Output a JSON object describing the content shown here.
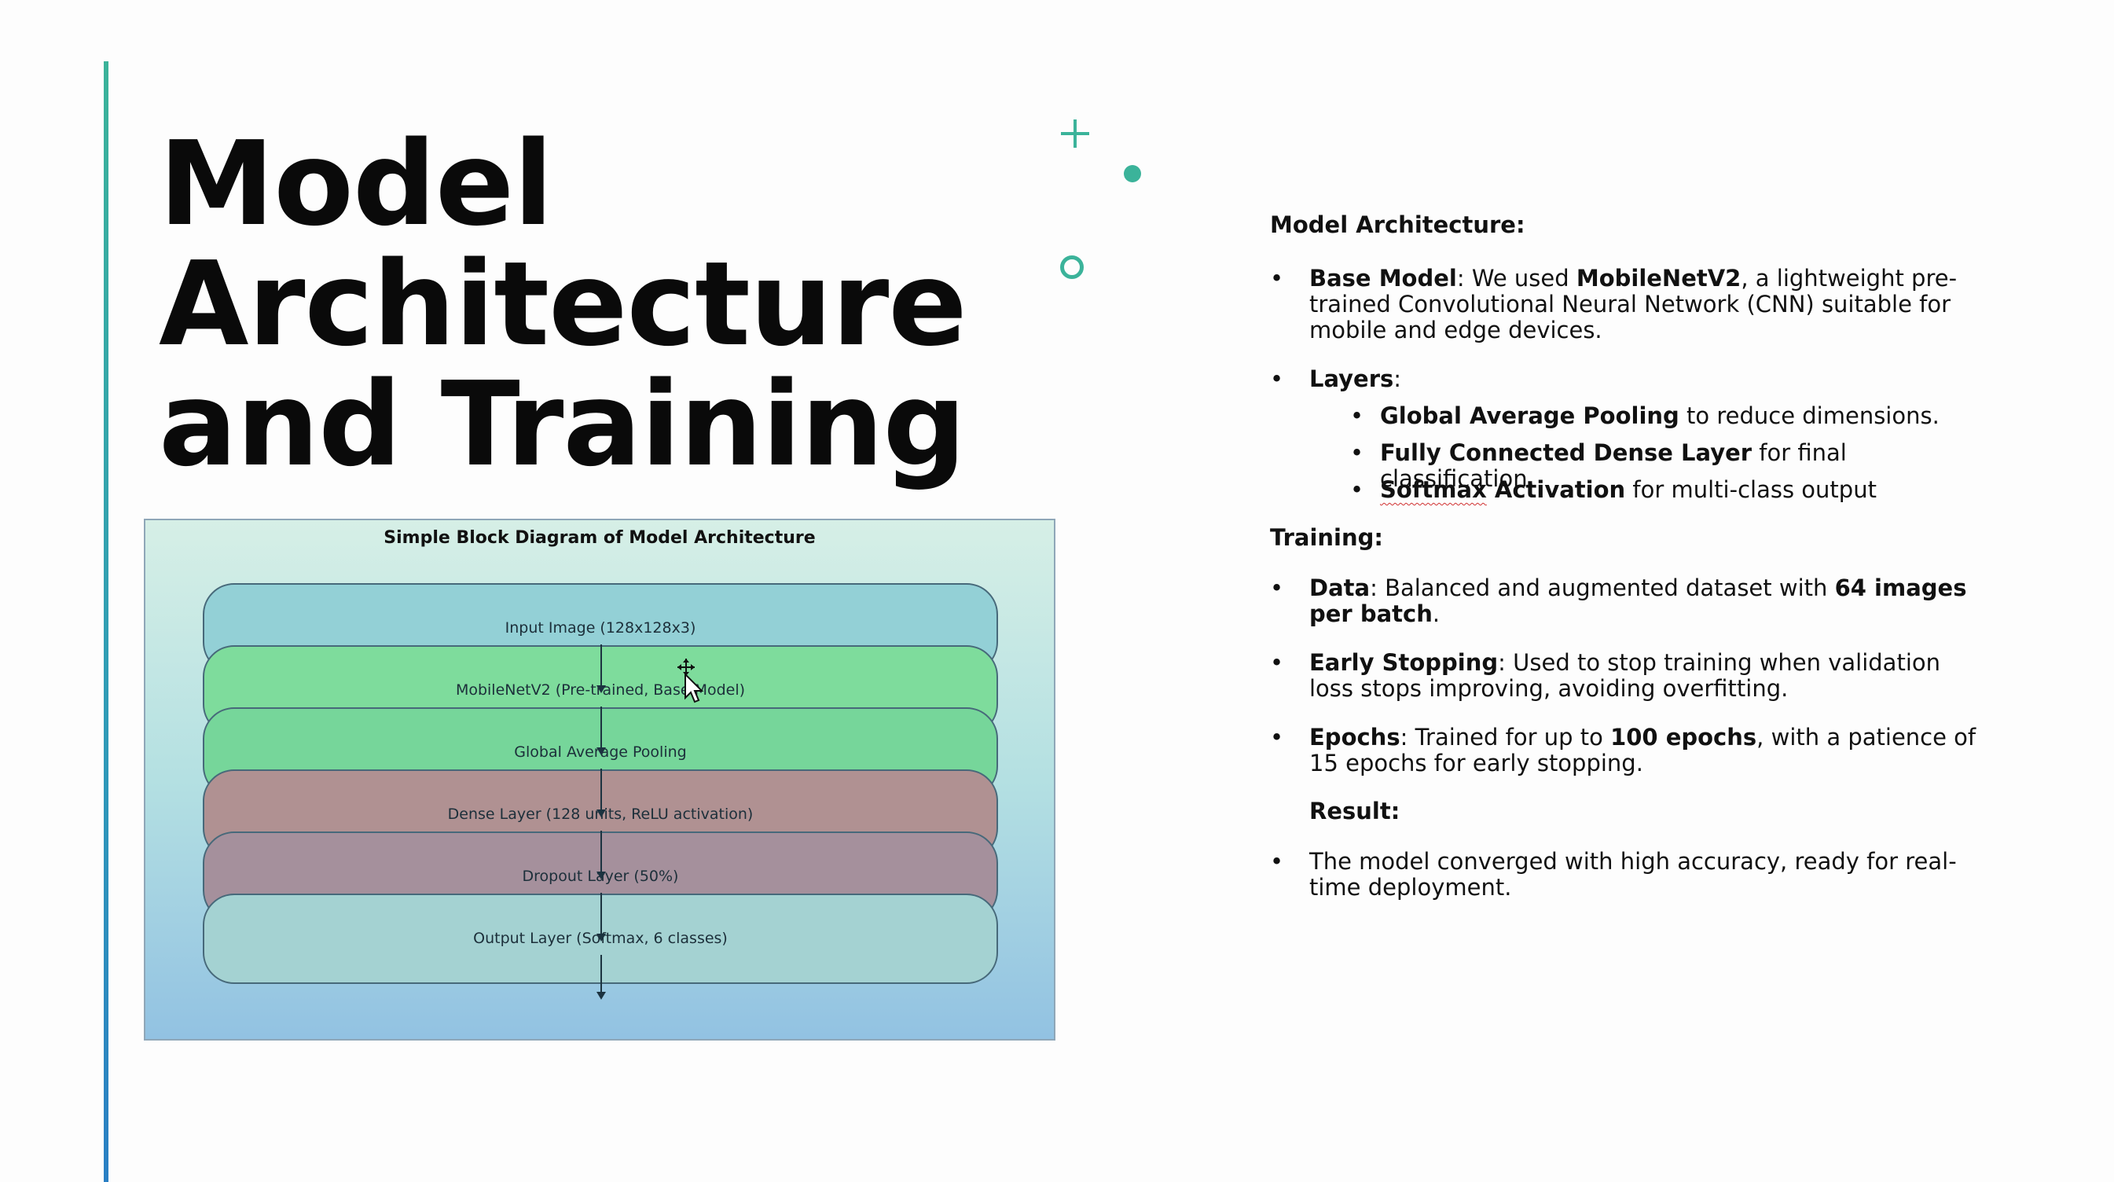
{
  "slide": {
    "title_lines": [
      "Model",
      "Architecture",
      "and Training"
    ]
  },
  "diagram": {
    "title": "Simple Block Diagram of Model Architecture",
    "layers": [
      {
        "label": "Input Image (128x128x3)",
        "color": "#93d0d6"
      },
      {
        "label": "MobileNetV2 (Pre-trained, Base Model)",
        "color": "#7edc9c"
      },
      {
        "label": "Global Average Pooling",
        "color": "#76d69a"
      },
      {
        "label": "Dense Layer (128 units, ReLU activation)",
        "color": "#b09192"
      },
      {
        "label": "Dropout Layer (50%)",
        "color": "#a5909c"
      },
      {
        "label": "Output Layer (Softmax, 6 classes)",
        "color": "#a4d2d2"
      }
    ]
  },
  "content": {
    "architecture_heading": "Model Architecture:",
    "base_model": {
      "term": "Base Model",
      "pre": ": We used ",
      "bold": "MobileNetV2",
      "post": ", a lightweight pre-trained Convolutional Neural Network (CNN) suitable for mobile and edge devices."
    },
    "layers_term": "Layers",
    "layers_colon": ":",
    "sub_layers": [
      {
        "bold": "Global Average Pooling",
        "rest": " to reduce dimensions."
      },
      {
        "bold": "Fully Connected Dense Layer",
        "rest": " for final classification."
      },
      {
        "bold_a": "Softmax",
        "bold_b": " Activation",
        "rest": " for multi-class output"
      }
    ],
    "training_heading": "Training:",
    "data": {
      "term": "Data",
      "pre": ": Balanced and augmented dataset with ",
      "bold": "64 images per batch",
      "post": "."
    },
    "early_stopping": {
      "term": "Early Stopping",
      "post": ": Used to stop training when validation loss stops improving, avoiding overfitting."
    },
    "epochs": {
      "term": "Epochs",
      "pre": ": Trained for up to ",
      "bold": "100 epochs",
      "post": ", with a patience of 15 epochs for early stopping."
    },
    "result_heading": "Result:",
    "result_text": "The model converged with high accuracy, ready for real-time deployment."
  },
  "colors": {
    "accent": "#3bb39a",
    "accent_bar_bottom": "#2a7fc4"
  }
}
